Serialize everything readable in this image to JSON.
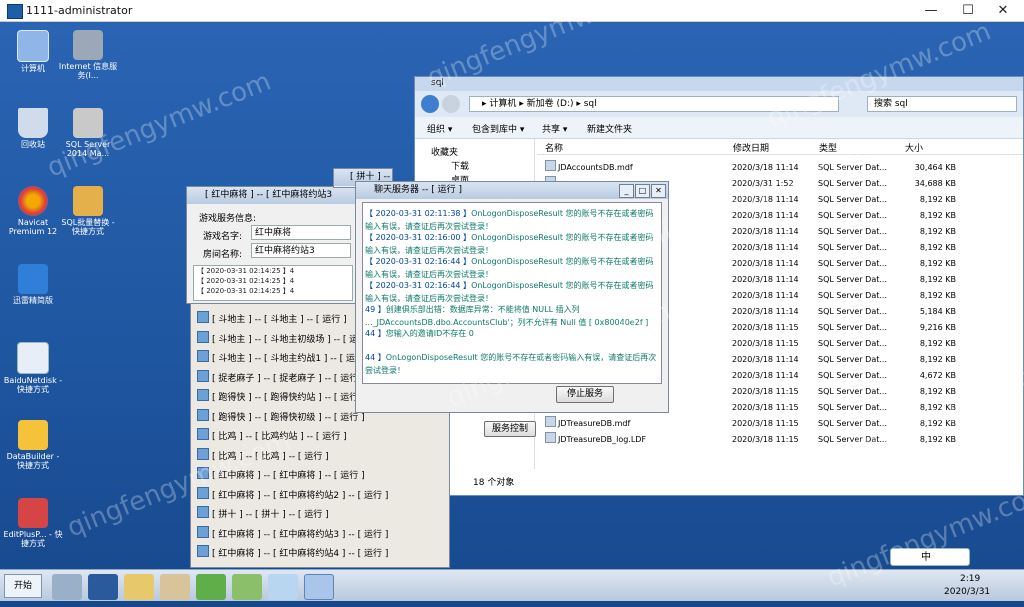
{
  "rdp": {
    "title": "1111-administrator",
    "min": "—",
    "max": "☐",
    "close": "✕"
  },
  "desktop_icons": [
    {
      "label": "计算机"
    },
    {
      "label": "Internet 信息服务(I..."
    },
    {
      "label": "回收站"
    },
    {
      "label": "SQL Server 2014 Ma..."
    },
    {
      "label": "Navicat Premium 12"
    },
    {
      "label": "SQL批量替换 - 快捷方式"
    },
    {
      "label": "迅雷精简版"
    },
    {
      "label": "BaiduNetdisk - 快捷方式"
    },
    {
      "label": "DataBuilder - 快捷方式"
    },
    {
      "label": "EditPlusP... - 快捷方式"
    }
  ],
  "explorer": {
    "title": "sql",
    "breadcrumb": "▸ 计算机 ▸ 新加卷 (D:) ▸ sql",
    "search_placeholder": "搜索 sql",
    "toolbar": [
      "组织 ▾",
      "包含到库中 ▾",
      "共享 ▾",
      "新建文件夹"
    ],
    "nav": [
      "收藏夹",
      "下载",
      "桌面"
    ],
    "columns": [
      "名称",
      "修改日期",
      "类型",
      "大小"
    ],
    "rows": [
      {
        "name": "JDAccountsDB.mdf",
        "date": "2020/3/18 11:14",
        "type": "SQL Server Dat...",
        "size": "30,464 KB"
      },
      {
        "name": "",
        "date": "2020/3/31 1:52",
        "type": "SQL Server Dat...",
        "size": "34,688 KB"
      },
      {
        "name": "",
        "date": "2020/3/18 11:14",
        "type": "SQL Server Dat...",
        "size": "8,192 KB"
      },
      {
        "name": "",
        "date": "2020/3/18 11:14",
        "type": "SQL Server Dat...",
        "size": "8,192 KB"
      },
      {
        "name": "",
        "date": "2020/3/18 11:14",
        "type": "SQL Server Dat...",
        "size": "8,192 KB"
      },
      {
        "name": "",
        "date": "2020/3/18 11:14",
        "type": "SQL Server Dat...",
        "size": "8,192 KB"
      },
      {
        "name": "",
        "date": "2020/3/18 11:14",
        "type": "SQL Server Dat...",
        "size": "8,192 KB"
      },
      {
        "name": "",
        "date": "2020/3/18 11:14",
        "type": "SQL Server Dat...",
        "size": "8,192 KB"
      },
      {
        "name": "",
        "date": "2020/3/18 11:14",
        "type": "SQL Server Dat...",
        "size": "8,192 KB"
      },
      {
        "name": "",
        "date": "2020/3/18 11:14",
        "type": "SQL Server Dat...",
        "size": "5,184 KB"
      },
      {
        "name": "",
        "date": "2020/3/18 11:15",
        "type": "SQL Server Dat...",
        "size": "9,216 KB"
      },
      {
        "name": "",
        "date": "2020/3/18 11:15",
        "type": "SQL Server Dat...",
        "size": "8,192 KB"
      },
      {
        "name": "",
        "date": "2020/3/18 11:14",
        "type": "SQL Server Dat...",
        "size": "8,192 KB"
      },
      {
        "name": "",
        "date": "2020/3/18 11:14",
        "type": "SQL Server Dat...",
        "size": "4,672 KB"
      },
      {
        "name": "",
        "date": "2020/3/18 11:15",
        "type": "SQL Server Dat...",
        "size": "8,192 KB"
      },
      {
        "name": "",
        "date": "2020/3/18 11:15",
        "type": "SQL Server Dat...",
        "size": "8,192 KB"
      },
      {
        "name": "JDTreasureDB.mdf",
        "date": "2020/3/18 11:15",
        "type": "SQL Server Dat...",
        "size": "8,192 KB"
      },
      {
        "name": "JDTreasureDB_log.LDF",
        "date": "2020/3/18 11:15",
        "type": "SQL Server Dat...",
        "size": "8,192 KB"
      }
    ],
    "status": "18 个对象"
  },
  "game_window": {
    "title": "[ 红中麻将 ] -- [ 红中麻将约站3",
    "section": "游戏服务信息:",
    "game_name_label": "游戏名字:",
    "game_name": "红中麻将",
    "room_label": "房间名称:",
    "room_name": "红中麻将约站3",
    "log_lines": [
      "【 2020-03-31 02:14:25 】4",
      "【 2020-03-31 02:14:25 】4",
      "【 2020-03-31 02:14:25 】4"
    ]
  },
  "hidden_title": "[ 拼十 ] -- [",
  "chat_window": {
    "title": "聊天服务器 -- [ 运行 ]",
    "stop_button": "停止服务",
    "logs": [
      {
        "ts": "【 2020-03-31 02:11:38 】",
        "msg": "OnLogonDisposeResult 您的账号不存在或者密码输入有误，请查证后再次尝试登录！"
      },
      {
        "ts": "【 2020-03-31 02:16:00 】",
        "msg": "OnLogonDisposeResult 您的账号不存在或者密码输入有误，请查证后再次尝试登录！"
      },
      {
        "ts": "【 2020-03-31 02:16:44 】",
        "msg": "OnLogonDisposeResult 您的账号不存在或者密码输入有误，请查证后再次尝试登录！"
      },
      {
        "ts": "【 2020-03-31 02:16:44 】",
        "msg": "OnLogonDisposeResult 您的账号不存在或者密码输入有误，请查证后再次尝试登录！"
      },
      {
        "ts": "49 】",
        "msg": "创建俱乐部出错：数据库异常：不能将值 NULL 插入列 ..._JDAccountsDB.dbo.AccountsClub'；列不允许有 Null 值 [ 0x80040e2f ]"
      },
      {
        "ts": "44 】",
        "msg": "您输入的邀请ID不存在 0"
      },
      {
        "ts": "44 】",
        "msg": "OnLogonDisposeResult 您的账号不存在或者密码输入有误，请查证后再次尝试登录！"
      }
    ]
  },
  "service_control": "服务控制",
  "room_menu": [
    "[ 斗地主 ] -- [ 斗地主 ] -- [ 运行 ]",
    "[ 斗地主 ] -- [ 斗地主初级场 ] -- [ 运行 ]",
    "[ 斗地主 ] -- [ 斗地主约战1 ] -- [ 运行 ]",
    "[ 捉老麻子 ] -- [ 捉老麻子 ] -- [ 运行 ]",
    "[ 跑得快 ] -- [ 跑得快约站 ] -- [ 运行 ]",
    "[ 跑得快 ] -- [ 跑得快初级 ] -- [ 运行 ]",
    "[ 比鸡 ] -- [ 比鸡约站 ] -- [ 运行 ]",
    "[ 比鸡 ] -- [ 比鸡 ] -- [ 运行 ]",
    "[ 红中麻将 ] -- [ 红中麻将 ] -- [ 运行 ]",
    "[ 红中麻将 ] -- [ 红中麻将约站2 ] -- [ 运行 ]",
    "[ 拼十 ] -- [ 拼十 ] -- [ 运行 ]",
    "[ 红中麻将 ] -- [ 红中麻将约站3 ] -- [ 运行 ]",
    "[ 红中麻将 ] -- [ 红中麻将约站4 ] -- [ 运行 ]"
  ],
  "taskbar": {
    "start": "开始",
    "time": "2:19",
    "date": "2020/3/31",
    "ime": "中"
  },
  "watermark": "qingfengymw.com"
}
